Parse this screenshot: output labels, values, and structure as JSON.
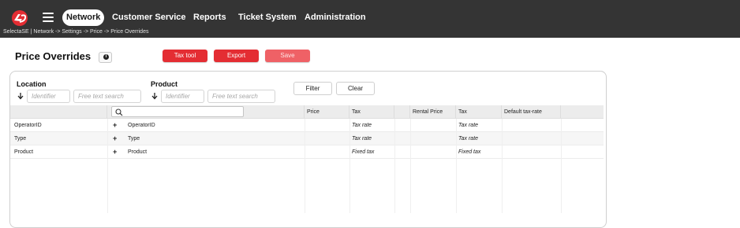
{
  "nav": {
    "items": [
      "Network",
      "Customer Service",
      "Reports",
      "Ticket System",
      "Administration"
    ],
    "active": "Network"
  },
  "breadcrumb": "SelectaSE | Network -> Settings -> Price -> Price Overrides",
  "page": {
    "title": "Price Overrides",
    "buttons": {
      "tax_tool": "Tax tool",
      "export": "Export",
      "save": "Save"
    }
  },
  "filters": {
    "location": {
      "label": "Location",
      "identifier_placeholder": "Identifier",
      "search_placeholder": "Free text search"
    },
    "product": {
      "label": "Product",
      "identifier_placeholder": "Identifier",
      "search_placeholder": "Free text search"
    },
    "filter_button": "Filter",
    "clear_button": "Clear"
  },
  "grid": {
    "columns": [
      "Price",
      "Tax",
      "Rental Price",
      "Tax",
      "Default tax-rate"
    ],
    "rows": [
      {
        "key": "OperatorID",
        "name": "OperatorID",
        "tax": "Tax rate",
        "rental_tax": "Tax rate"
      },
      {
        "key": "Type",
        "name": "Type",
        "tax": "Tax rate",
        "rental_tax": "Tax rate"
      },
      {
        "key": "Product",
        "name": "Product",
        "tax": "Fixed tax",
        "rental_tax": "Fixed tax"
      }
    ]
  },
  "icons": [
    "logo-icon",
    "hamburger-icon",
    "info-icon",
    "sort-down-icon",
    "search-icon",
    "plus-icon"
  ],
  "colors": {
    "topbar": "#343434",
    "accent_red": "#e42d33",
    "disabled_red": "#ef6166"
  }
}
